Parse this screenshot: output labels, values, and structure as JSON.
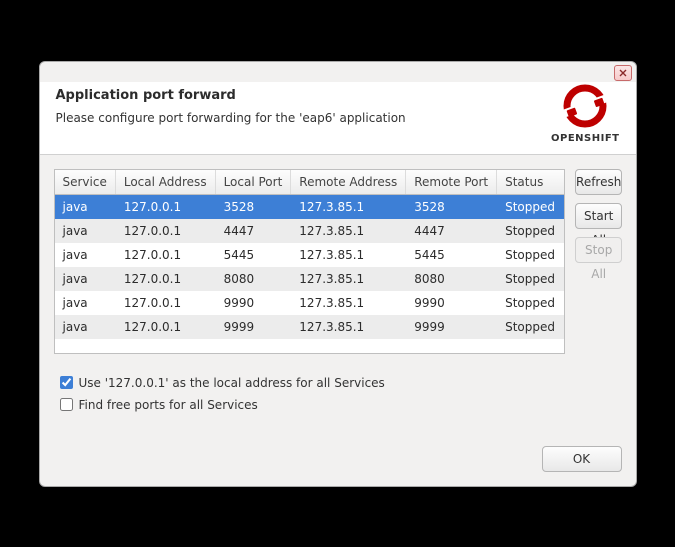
{
  "header": {
    "title": "Application port forward",
    "subtitle": "Please configure port forwarding for the 'eap6' application"
  },
  "logo": {
    "label": "OPENSHIFT"
  },
  "table": {
    "headers": {
      "service": "Service",
      "local_address": "Local Address",
      "local_port": "Local Port",
      "remote_address": "Remote Address",
      "remote_port": "Remote Port",
      "status": "Status"
    },
    "rows": [
      {
        "service": "java",
        "local_address": "127.0.0.1",
        "local_port": "3528",
        "remote_address": "127.3.85.1",
        "remote_port": "3528",
        "status": "Stopped",
        "selected": true
      },
      {
        "service": "java",
        "local_address": "127.0.0.1",
        "local_port": "4447",
        "remote_address": "127.3.85.1",
        "remote_port": "4447",
        "status": "Stopped"
      },
      {
        "service": "java",
        "local_address": "127.0.0.1",
        "local_port": "5445",
        "remote_address": "127.3.85.1",
        "remote_port": "5445",
        "status": "Stopped"
      },
      {
        "service": "java",
        "local_address": "127.0.0.1",
        "local_port": "8080",
        "remote_address": "127.3.85.1",
        "remote_port": "8080",
        "status": "Stopped"
      },
      {
        "service": "java",
        "local_address": "127.0.0.1",
        "local_port": "9990",
        "remote_address": "127.3.85.1",
        "remote_port": "9990",
        "status": "Stopped"
      },
      {
        "service": "java",
        "local_address": "127.0.0.1",
        "local_port": "9999",
        "remote_address": "127.3.85.1",
        "remote_port": "9999",
        "status": "Stopped"
      }
    ]
  },
  "buttons": {
    "refresh": "Refresh",
    "start_all": "Start All",
    "stop_all": "Stop All",
    "ok": "OK"
  },
  "checkboxes": {
    "use_local": {
      "label": "Use '127.0.0.1' as the local address for all Services",
      "checked": true
    },
    "find_free": {
      "label": "Find free ports for all Services",
      "checked": false
    }
  }
}
